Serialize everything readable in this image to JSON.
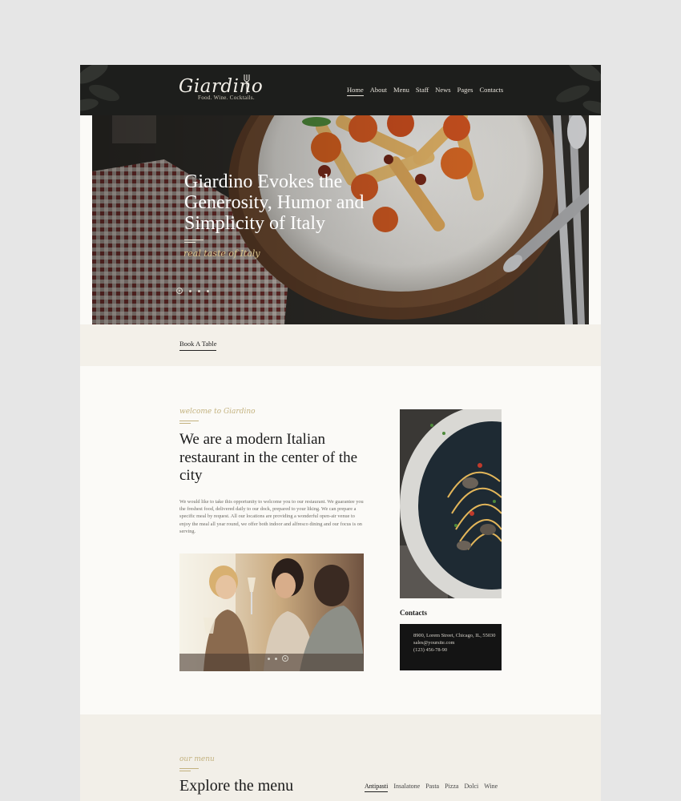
{
  "brand": {
    "name": "Giardino",
    "tagline": "Food. Wine. Cocktails."
  },
  "nav": {
    "items": [
      {
        "label": "Home",
        "active": true
      },
      {
        "label": "About"
      },
      {
        "label": "Menu"
      },
      {
        "label": "Staff"
      },
      {
        "label": "News"
      },
      {
        "label": "Pages"
      },
      {
        "label": "Contacts"
      }
    ]
  },
  "hero": {
    "title": "Giardino Evokes the Generosity, Humor and Simplicity of Italy",
    "subtitle": "real taste of Italy",
    "slides": 4,
    "active_slide": 1
  },
  "book_table": "Book A Table",
  "welcome": {
    "label": "welcome to Giardino",
    "heading": "We are a modern Italian restaurant in the center of the city",
    "body": "We would like to take this opportunity to welcome you to our restaurant. We guarantee you the freshest food, delivered daily to our dock, prepared to your liking. We can prepare a specific meal by request. All our locations are providing a wonderful open-air venue to enjoy the meal all year round, we offer both indoor and alfresco dining and our focus is on serving."
  },
  "contacts": {
    "heading": "Contacts",
    "address": "8900, Lorem Street, Chicago, IL, 55030",
    "email": "sales@yoursite.com",
    "phone": "(123) 456-78-90"
  },
  "menu": {
    "label": "our menu",
    "title": "Explore the menu",
    "tabs": [
      {
        "label": "Antipasti",
        "active": true
      },
      {
        "label": "Insalatone"
      },
      {
        "label": "Pasta"
      },
      {
        "label": "Pizza"
      },
      {
        "label": "Dolci"
      },
      {
        "label": "Wine"
      }
    ]
  },
  "colors": {
    "header_bg": "#1d1e1c",
    "accent_gold": "#c3b27f",
    "page_bg": "#fbfaf7"
  }
}
